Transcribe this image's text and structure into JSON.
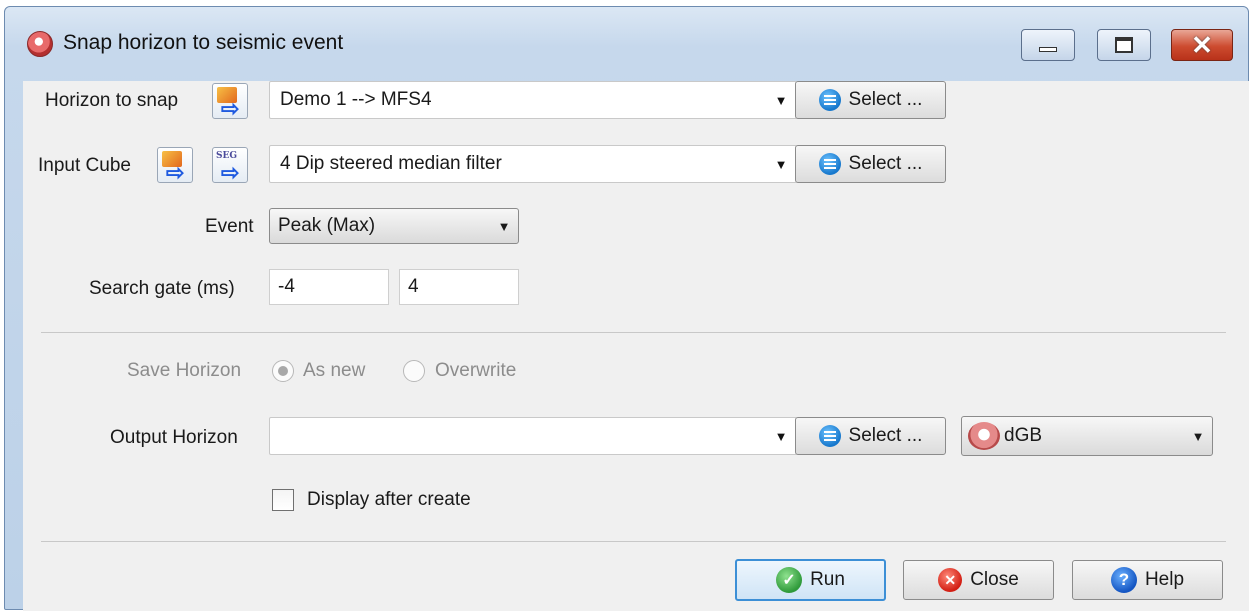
{
  "window": {
    "title": "Snap horizon to seismic event",
    "minimize_label": "",
    "maximize_label": "",
    "close_glyph": "✕"
  },
  "horizon_to_snap": {
    "label": "Horizon to snap",
    "value": "Demo 1 --> MFS4",
    "select_label": "Select ..."
  },
  "input_cube": {
    "label": "Input Cube",
    "value": "4 Dip steered median filter",
    "select_label": "Select ...",
    "seg_icon_text": "SEG"
  },
  "event": {
    "label": "Event",
    "value": "Peak (Max)"
  },
  "search_gate": {
    "label": "Search gate (ms)",
    "from": "-4",
    "to": "4"
  },
  "save_horizon": {
    "label": "Save Horizon",
    "options": [
      "As new",
      "Overwrite"
    ],
    "selected": "As new"
  },
  "output_horizon": {
    "label": "Output Horizon",
    "value": "",
    "select_label": "Select ...",
    "survey": "dGB"
  },
  "display_after_create": {
    "label": "Display after create",
    "checked": false
  },
  "buttons": {
    "run": "Run",
    "close": "Close",
    "help": "Help"
  },
  "icons": {
    "arrow_glyph": "⇨",
    "dropdown_glyph": "▼",
    "run_glyph": "✓",
    "close_glyph": "✕",
    "help_glyph": "?"
  }
}
